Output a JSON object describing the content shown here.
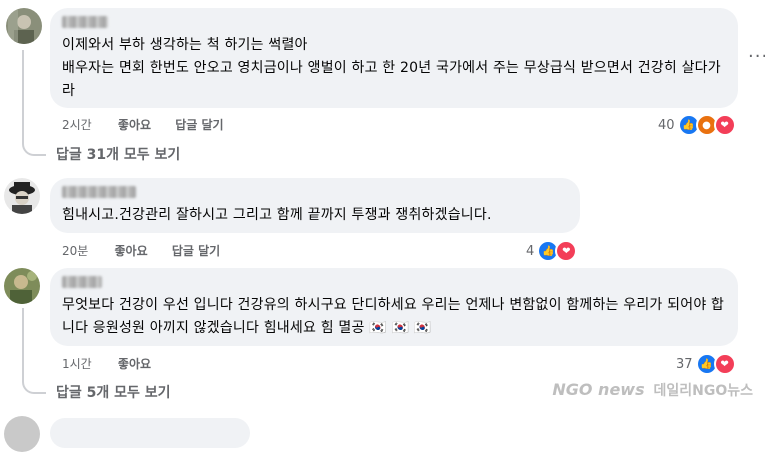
{
  "comments": [
    {
      "author_blurred": true,
      "text": "이제와서 부하 생각하는 척 하기는 썩렬아\n배우자는 면회 한번도 안오고 영치금이나 앵벌이 하고 한 20년 국가에서 주는 무상급식 받으면서 건강히 살다가라",
      "time": "2시간",
      "like_label": "좋아요",
      "reply_label": "답글 달기",
      "reaction_count": "40",
      "reaction_icons": [
        "like-icon",
        "angry-icon",
        "love-icon"
      ]
    },
    {
      "author_blurred": true,
      "text": "힘내시고.건강관리 잘하시고 그리고 함께 끝까지 투쟁과 쟁취하겠습니다.",
      "time": "20분",
      "like_label": "좋아요",
      "reply_label": "답글 달기",
      "reaction_count": "4",
      "reaction_icons": [
        "like-icon",
        "love-icon"
      ]
    },
    {
      "author_blurred": true,
      "text": "무엇보다 건강이 우선 입니다 건강유의 하시구요 단디하세요 우리는 언제나 변함없이 함께하는 우리가 되어야 합니다 응원성원 아끼지 않겠습니다 힘내세요 힘 멸공 🇰🇷 🇰🇷 🇰🇷",
      "time": "1시간",
      "like_label": "좋아요",
      "reaction_count": "37",
      "reaction_icons": [
        "like-icon",
        "love-icon"
      ]
    }
  ],
  "view_replies": [
    "답글 31개 모두 보기",
    "답글 5개 모두 보기"
  ],
  "more_menu": "···",
  "watermark": {
    "logo": "NGO news",
    "text": "데일리NGO뉴스"
  },
  "colors": {
    "bubble": "#f0f2f5",
    "like": "#1877f2",
    "love": "#f33e58",
    "angry": "#e9710f",
    "meta": "#65676b"
  }
}
